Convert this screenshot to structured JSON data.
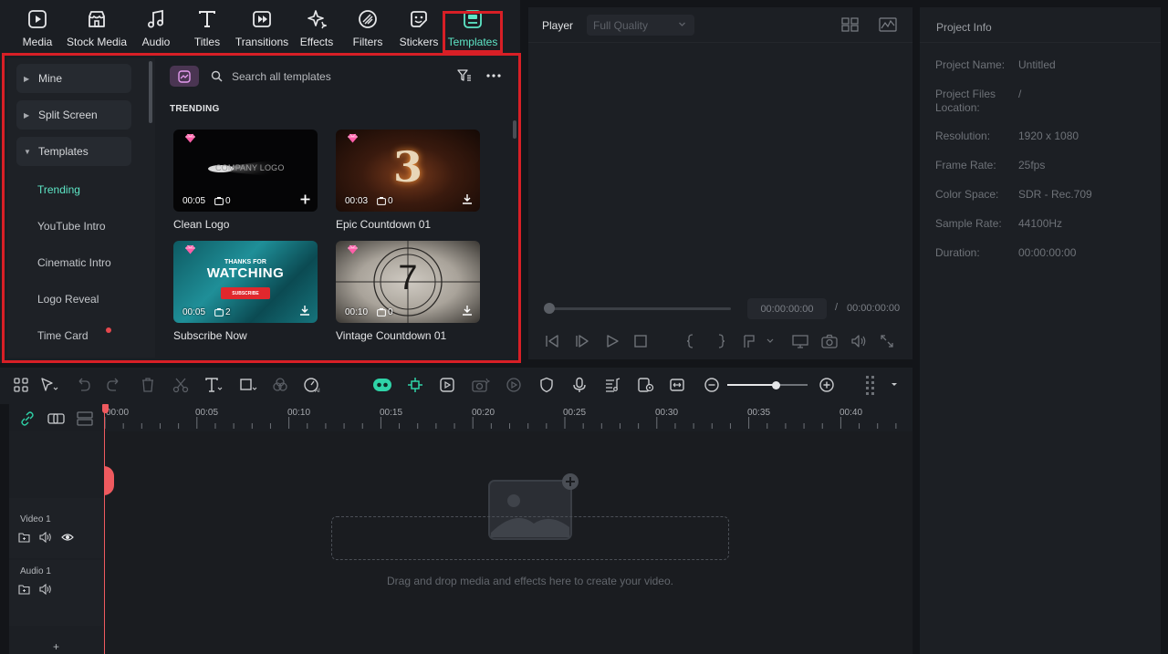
{
  "tabs": [
    {
      "label": "Media",
      "icon": "media-icon"
    },
    {
      "label": "Stock Media",
      "icon": "stock-media-icon"
    },
    {
      "label": "Audio",
      "icon": "music-note-icon"
    },
    {
      "label": "Titles",
      "icon": "text-t-icon"
    },
    {
      "label": "Transitions",
      "icon": "transition-icon"
    },
    {
      "label": "Effects",
      "icon": "sparkle-icon"
    },
    {
      "label": "Filters",
      "icon": "filter-icon"
    },
    {
      "label": "Stickers",
      "icon": "sticker-icon"
    },
    {
      "label": "Templates",
      "icon": "templates-icon",
      "active": true
    }
  ],
  "library": {
    "categories": [
      {
        "label": "Mine",
        "expanded": false
      },
      {
        "label": "Split Screen",
        "expanded": false
      },
      {
        "label": "Templates",
        "expanded": true
      }
    ],
    "subcategories": [
      "Trending",
      "YouTube Intro",
      "Cinematic Intro",
      "Logo Reveal",
      "Time Card"
    ],
    "active_subcategory": "Trending",
    "search_placeholder": "Search all templates",
    "section_heading": "TRENDING",
    "cards": [
      {
        "title": "Clean Logo",
        "duration": "00:05",
        "clip_count": "0",
        "action": "add",
        "thumb_text": "COMPANY LOGO"
      },
      {
        "title": "Epic Countdown 01",
        "duration": "00:03",
        "clip_count": "0",
        "action": "download",
        "thumb_text": "3"
      },
      {
        "title": "Subscribe Now",
        "duration": "00:05",
        "clip_count": "2",
        "action": "download",
        "thumb_text_small": "THANKS FOR",
        "thumb_text": "WATCHING",
        "thumb_button": "SUBSCRIBE"
      },
      {
        "title": "Vintage Countdown 01",
        "duration": "00:10",
        "clip_count": "0",
        "action": "download",
        "thumb_text": "7"
      }
    ]
  },
  "player": {
    "label": "Player",
    "quality": "Full Quality",
    "current_time": "00:00:00:00",
    "separator": "/",
    "total_time": "00:00:00:00"
  },
  "project_info": {
    "title": "Project Info",
    "rows": [
      {
        "label": "Project Name:",
        "value": "Untitled"
      },
      {
        "label": "Project Files Location:",
        "value": "/"
      },
      {
        "label": "Resolution:",
        "value": "1920 x 1080"
      },
      {
        "label": "Frame Rate:",
        "value": "25fps"
      },
      {
        "label": "Color Space:",
        "value": "SDR - Rec.709"
      },
      {
        "label": "Sample Rate:",
        "value": "44100Hz"
      },
      {
        "label": "Duration:",
        "value": "00:00:00:00"
      }
    ]
  },
  "timeline": {
    "ruler": [
      "00:00",
      "00:05",
      "00:10",
      "00:15",
      "00:20",
      "00:25",
      "00:30",
      "00:35",
      "00:40"
    ],
    "tracks": [
      {
        "name": "Video 1"
      },
      {
        "name": "Audio 1"
      }
    ],
    "drop_hint": "Drag and drop media and effects here to create your video.",
    "add_track": "+",
    "zoom_level": 0.6
  },
  "colors": {
    "accent": "#5ee6c6",
    "highlight_frame": "#d81f26",
    "playhead": "#ef5a5f"
  }
}
